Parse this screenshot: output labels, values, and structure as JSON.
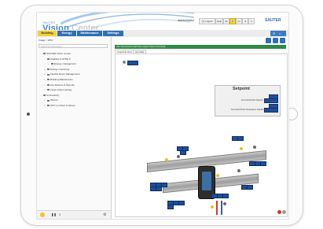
{
  "app": {
    "logo_top": "SAUTER",
    "logo_word1": "Vision",
    "logo_word2": " Center",
    "admin_label": "Administrator",
    "header_buttons": [
      "(7) Logout",
      "Help",
      "de",
      "fr",
      "en",
      "nl",
      "it"
    ],
    "active_header_button": 3,
    "brand": "SAUTER"
  },
  "nav": {
    "tabs": [
      "Building",
      "Energy",
      "Maintenance",
      "Settings"
    ],
    "active": 0
  },
  "sidebar": {
    "breadcrumb": "Image > WFC",
    "search_placeholder": "Search for documents",
    "tree": [
      {
        "label": "SAUTER Vision Center",
        "level": 0,
        "toggle": "−"
      },
      {
        "label": "Usability & HTML 5",
        "level": 1,
        "toggle": "−"
      },
      {
        "label": "Energy management",
        "level": 2,
        "toggle": "+"
      },
      {
        "label": "Energy monitoring",
        "level": 1,
        "toggle": "+"
      },
      {
        "label": "Flexible Room Management",
        "level": 1,
        "toggle": "+"
      },
      {
        "label": "Building Maintenance",
        "level": 1,
        "toggle": "+"
      },
      {
        "label": "Life Science & Security",
        "level": 1,
        "toggle": "+"
      },
      {
        "label": "Large scale topology",
        "level": 1,
        "toggle": "+"
      },
      {
        "label": "Connectivity",
        "level": 0,
        "toggle": "−"
      },
      {
        "label": "WeCon",
        "level": 1,
        "toggle": "+"
      },
      {
        "label": "OPC on Client & Server",
        "level": 1,
        "toggle": "+"
      }
    ],
    "footer_number": "1"
  },
  "content": {
    "notice": "Info: Documents that have system have incorrectly",
    "view_tabs": [
      "Graphical View",
      "List View"
    ],
    "active_view": 0
  },
  "setpoint": {
    "title": "Setpoint",
    "row1_label": "Set Control Point Setpoint",
    "row2_label": "Set Control Point Temperature Setpoint"
  },
  "colors": {
    "nav_blue": "#2f6fb5",
    "nav_active": "#f2d235",
    "notice_green": "#2e8a45",
    "value_badge": "#1f4e9a",
    "brand_blue": "#3567b0"
  }
}
